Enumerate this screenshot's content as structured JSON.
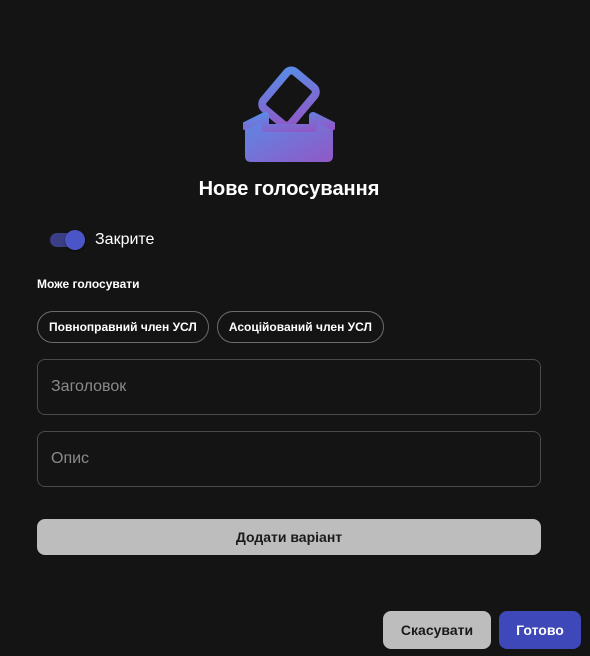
{
  "dialog": {
    "icon": "ballot-box-icon",
    "title": "Нове голосування",
    "colors": {
      "background": "#141414",
      "accent": "#3f48b8",
      "icon_gradient_start": "#5a7fe0",
      "icon_gradient_end": "#8e5cc9"
    }
  },
  "closed_toggle": {
    "label": "Закрите",
    "checked": true
  },
  "voters": {
    "label": "Може голосувати",
    "options": [
      {
        "label": "Повноправний член УСЛ"
      },
      {
        "label": "Асоційований член УСЛ"
      }
    ]
  },
  "form": {
    "title_placeholder": "Заголовок",
    "title_value": "",
    "description_placeholder": "Опис",
    "description_value": ""
  },
  "actions": {
    "add_option_label": "Додати варіант",
    "cancel_label": "Скасувати",
    "done_label": "Готово"
  }
}
